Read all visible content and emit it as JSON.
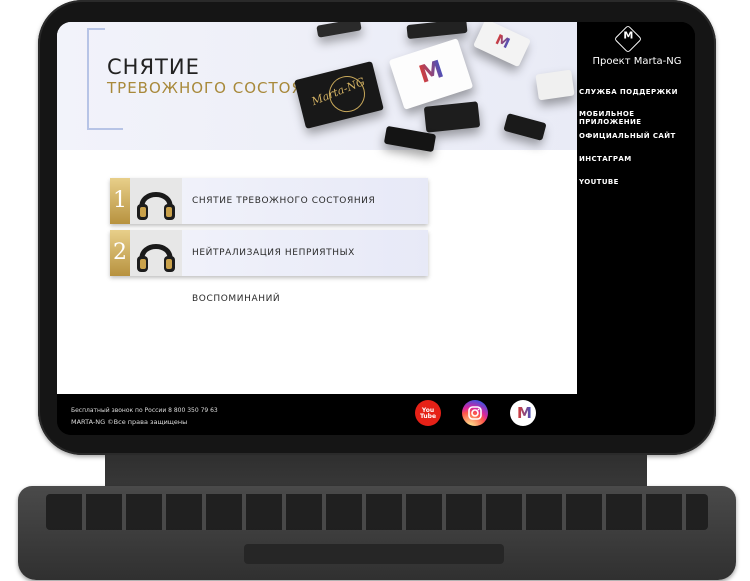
{
  "hero": {
    "title_line1": "СНЯТИЕ",
    "title_line2": "ТРЕВОЖНОГО СОСТОЯНИЯ",
    "card_text": "Marta-NG",
    "logo_letter": "M"
  },
  "tracks": [
    {
      "num": "1",
      "label": "СНЯТИЕ ТРЕВОЖНОГО СОСТОЯНИЯ"
    },
    {
      "num": "2",
      "label": "НЕЙТРАЛИЗАЦИЯ НЕПРИЯТНЫХ ВОСПОМИНАНИЙ"
    }
  ],
  "sidebar": {
    "logo_letter": "M",
    "brand": "Проект Marta-NG",
    "nav": [
      {
        "label": "СЛУЖБА ПОДДЕРЖКИ"
      },
      {
        "label": "МОБИЛЬНОЕ ПРИЛОЖЕНИЕ"
      },
      {
        "label": "ОФИЦИАЛЬНЫЙ САЙТ"
      },
      {
        "label": "ИНСТАГРАМ"
      },
      {
        "label": "YOUTUBE"
      }
    ]
  },
  "footer": {
    "phone": "Бесплатный звонок по России 8 800 350 79 63",
    "copyright": "MARTA-NG ©Все права защищены",
    "youtube_label": "You Tube",
    "app_letter": "M"
  },
  "colors": {
    "gold": "#b7923f",
    "youtube": "#e62117"
  }
}
